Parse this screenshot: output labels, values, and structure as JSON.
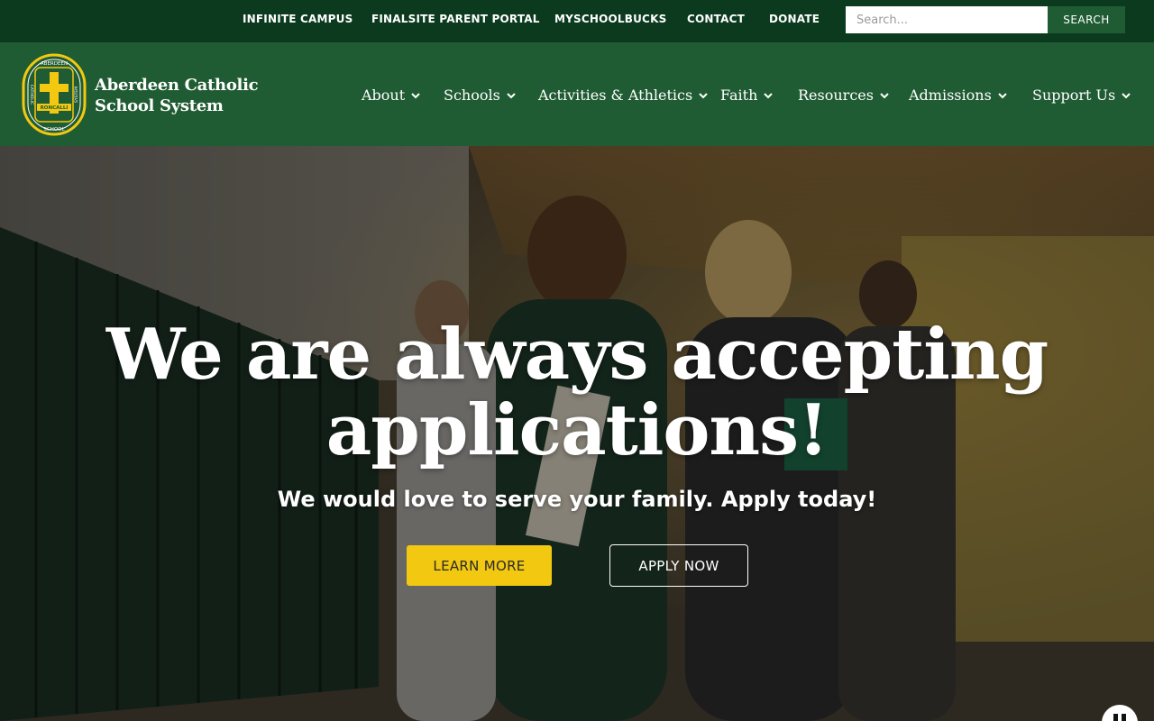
{
  "utility_bar": {
    "links": [
      "INFINITE CAMPUS",
      "FINALSITE PARENT PORTAL",
      "MYSCHOOLBUCKS",
      "CONTACT",
      "DONATE"
    ],
    "search_placeholder": "Search...",
    "search_button": "SEARCH"
  },
  "header": {
    "logo_line1": "Aberdeen Catholic",
    "logo_line2": "School System",
    "seal_text_top": "ABERDEEN",
    "seal_text_left": "CATHOLIC",
    "seal_text_right": "SYSTEM",
    "seal_text_bottom": "SCHOOL",
    "seal_banner": "RONCALLI",
    "nav": [
      "About",
      "Schools",
      "Activities & Athletics",
      "Faith",
      "Resources",
      "Admissions",
      "Support Us"
    ]
  },
  "hero": {
    "title_line1": "We are always accepting",
    "title_line2": "applications!",
    "subtitle": "We would love to serve your family. Apply today!",
    "learn_more": "LEARN MORE",
    "apply_now": "APPLY NOW"
  },
  "colors": {
    "utility_bg": "#0b3a1f",
    "header_bg": "#205c33",
    "accent_yellow": "#f2c811",
    "search_button_bg": "#1f5c33"
  },
  "icons": {
    "nav_chevron": "chevron-down-icon",
    "logo": "cross-seal-icon",
    "video_control": "pause-icon"
  }
}
